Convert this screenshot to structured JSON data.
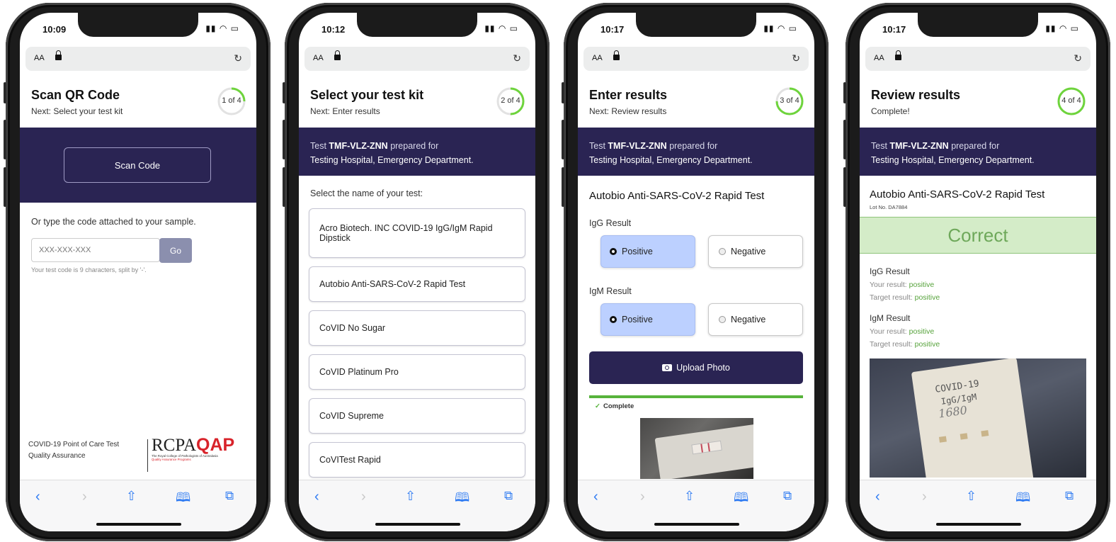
{
  "status_time": [
    "10:09",
    "10:12",
    "10:17",
    "10:17"
  ],
  "browser": {
    "text_size_label": "AA"
  },
  "colors": {
    "brand_navy": "#2a2453",
    "progress_green": "#6ed43c",
    "correct_bg": "#d4ecc8"
  },
  "prepared": {
    "prefix": "Test ",
    "code": "TMF-VLZ-ZNN",
    "mid": " prepared for",
    "facility": "Testing Hospital, Emergency Department."
  },
  "screen1": {
    "title": "Scan QR Code",
    "next": "Next: Select your test kit",
    "step": "1 of 4",
    "progress": 0.25,
    "scan_button": "Scan Code",
    "type_prompt": "Or type the code attached to your sample.",
    "code_placeholder": "XXX-XXX-XXX",
    "go_button": "Go",
    "code_hint": "Your test code is 9 characters, split by '-'.",
    "footer_line1": "COVID-19 Point of Care Test",
    "footer_line2": "Quality Assurance",
    "logo_a": "RCPA",
    "logo_b": "QAP",
    "logo_sub1": "The Royal College of Pathologists of Australasia",
    "logo_sub2": "Quality Assurance Programs"
  },
  "screen2": {
    "title": "Select your test kit",
    "next": "Next: Enter results",
    "step": "2 of 4",
    "progress": 0.5,
    "select_prompt": "Select the name of your test:",
    "kits": [
      "Acro Biotech. INC COVID-19 IgG/IgM Rapid Dipstick",
      "Autobio Anti-SARS-CoV-2 Rapid Test",
      "CoVID No Sugar",
      "CoVID Platinum Pro",
      "CoVID Supreme",
      "CoVITest Rapid"
    ]
  },
  "screen3": {
    "title": "Enter results",
    "next": "Next: Review results",
    "step": "3 of 4",
    "progress": 0.75,
    "test_name": "Autobio Anti-SARS-CoV-2 Rapid Test",
    "igg_label": "IgG Result",
    "igm_label": "IgM Result",
    "positive": "Positive",
    "negative": "Negative",
    "upload_button": "Upload Photo",
    "upload_status": "Complete"
  },
  "screen4": {
    "title": "Review results",
    "next": "Complete!",
    "step": "4 of 4",
    "progress": 1.0,
    "test_name": "Autobio Anti-SARS-CoV-2 Rapid Test",
    "lot": "Lot No. DA7884",
    "verdict": "Correct",
    "igg_label": "IgG Result",
    "igm_label": "IgM Result",
    "your_result": "Your result: ",
    "target_result": "Target result: ",
    "value": "positive",
    "photo_text1": "COVID-19",
    "photo_text2": "IgG/IgM",
    "photo_text3": "1680"
  }
}
